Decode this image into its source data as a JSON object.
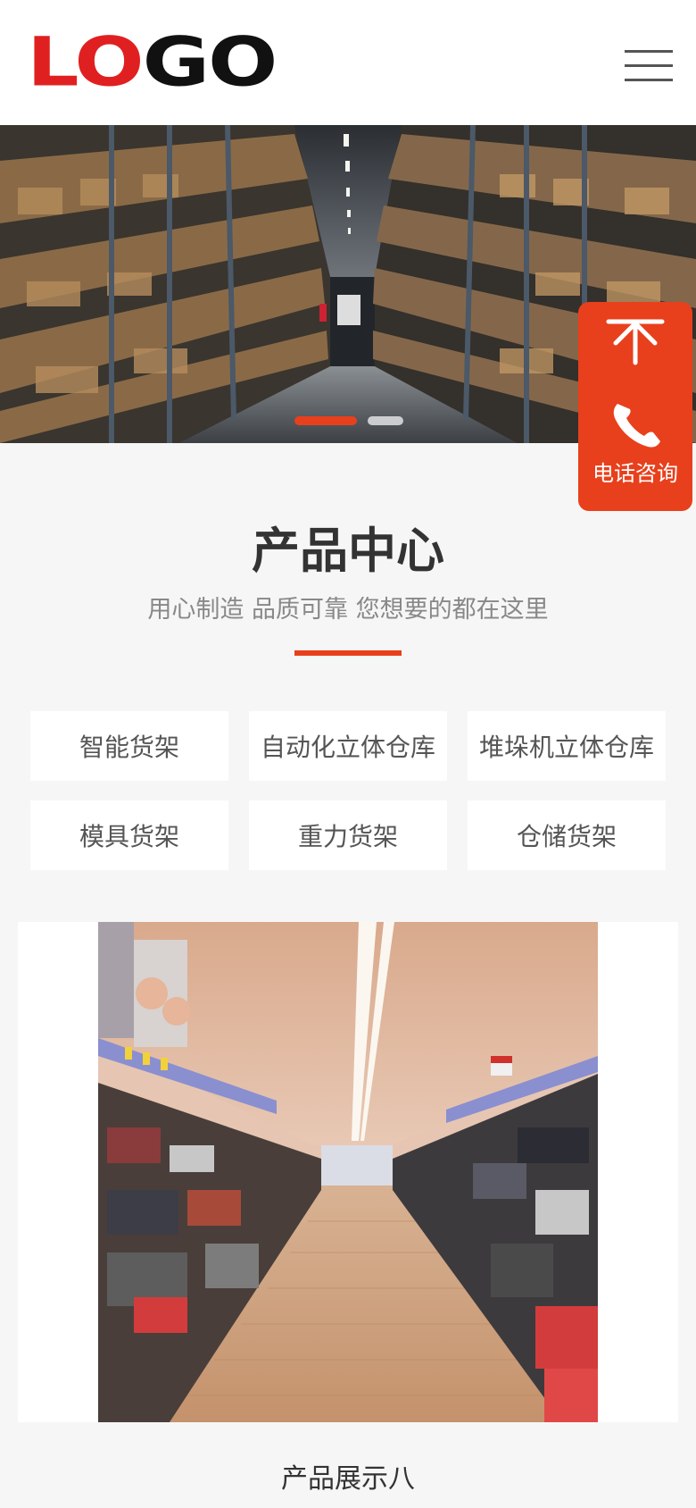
{
  "header": {
    "logo_part1": "LO",
    "logo_part2": "GO"
  },
  "banner": {
    "slide_count": 2,
    "active_slide": 1
  },
  "float_contact": {
    "phone_label": "电话咨询"
  },
  "section": {
    "title": "产品中心",
    "subtitle": "用心制造 品质可靠 您想要的都在这里"
  },
  "categories": [
    "智能货架",
    "自动化立体仓库",
    "堆垛机立体仓库",
    "模具货架",
    "重力货架",
    "仓储货架"
  ],
  "product": {
    "name": "产品展示八"
  },
  "colors": {
    "accent": "#e8401c",
    "background": "#f6f6f6",
    "logo_red": "#e02020",
    "logo_black": "#111111"
  },
  "icons": {
    "menu": "hamburger-icon",
    "back_to_top": "arrow-up-icon",
    "phone": "phone-icon"
  }
}
